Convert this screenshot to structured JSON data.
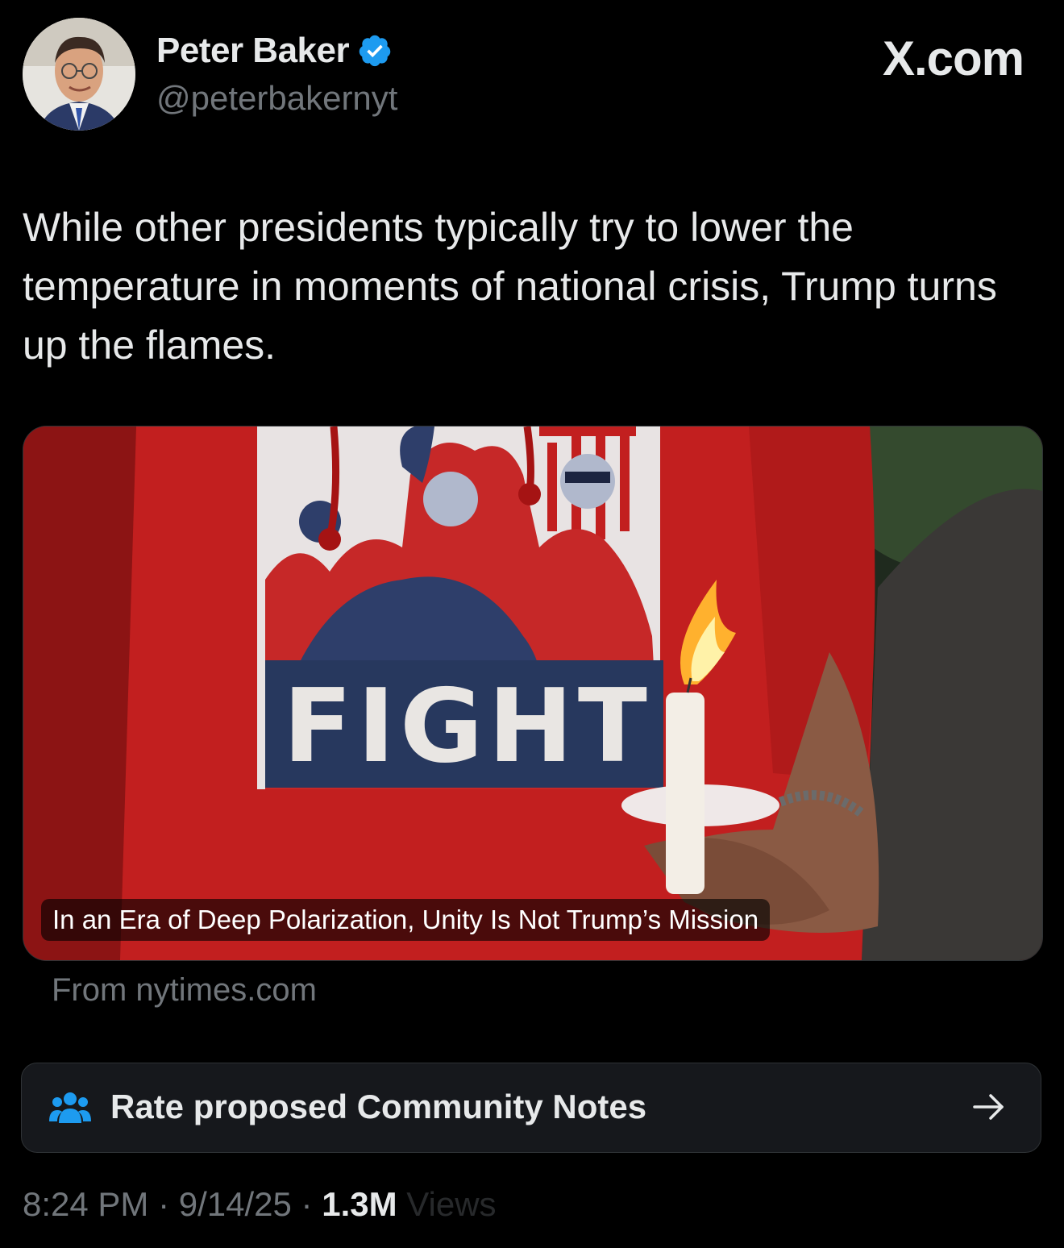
{
  "author": {
    "name": "Peter Baker",
    "handle": "@peterbakernyt",
    "verified": true,
    "avatar_icon": "person-avatar"
  },
  "brand": "X.com",
  "tweet": {
    "text": "While other presidents typically try to lower the temperature in moments of national crisis, Trump turns up the flames."
  },
  "card": {
    "headline": "In an Era of Deep Polarization, Unity Is Not Trump’s Mission",
    "shirt_text": "FIGHT",
    "source": "From nytimes.com"
  },
  "community_notes": {
    "label": "Rate proposed Community Notes",
    "icon": "people-icon",
    "arrow_icon": "arrow-right-icon"
  },
  "meta": {
    "time": "8:24 PM",
    "date": "9/14/25",
    "separator": " · ",
    "views_count": "1.3M",
    "views_label": "Views"
  },
  "colors": {
    "background": "#000000",
    "text_primary": "#e7e9ea",
    "text_secondary": "#71767b",
    "verified_blue": "#1d9bf0",
    "notes_bg": "#16181c"
  }
}
